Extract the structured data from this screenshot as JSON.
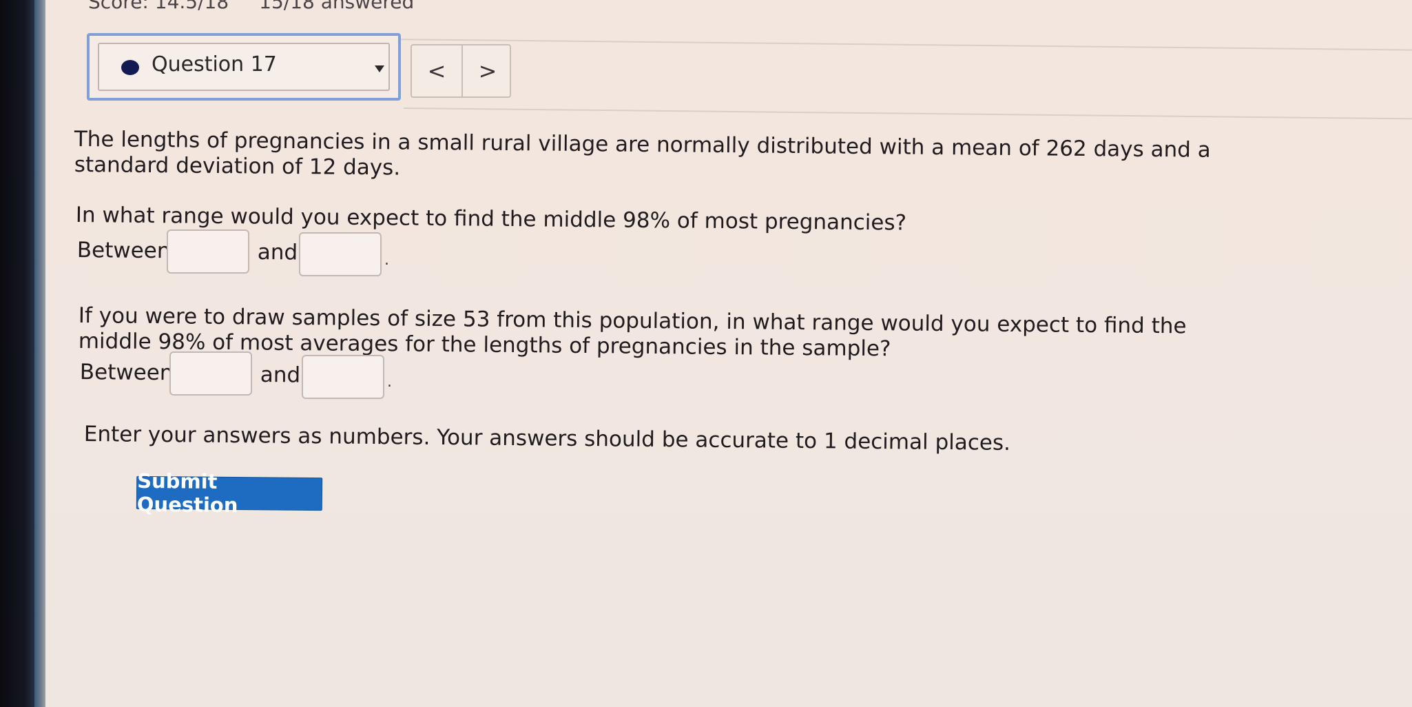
{
  "header": {
    "score_text": "Score: 14.5/18",
    "answered_text": "15/18 answered"
  },
  "question_nav": {
    "selected_question": "Question 17",
    "prev_label": "<",
    "next_label": ">"
  },
  "question": {
    "intro_line1": "The lengths of pregnancies in a small rural village are normally distributed with a mean of 262 days and a",
    "intro_line2": "standard deviation of 12 days.",
    "part1_prompt": "In what range would you expect to find the middle 98% of most pregnancies?",
    "part1_between": "Between",
    "part1_and": "and",
    "part1_period": ".",
    "part2_prompt_line1": "If you were to draw samples of size 53 from this population, in what range would you expect to find the",
    "part2_prompt_line2": "middle 98% of most averages for the lengths of pregnancies in the sample?",
    "part2_between": "Between",
    "part2_and": "and",
    "part2_period": ".",
    "instructions": "Enter your answers as numbers. Your answers should be accurate to 1 decimal places."
  },
  "inputs": {
    "part1_low_value": "",
    "part1_high_value": "",
    "part2_low_value": "",
    "part2_high_value": ""
  },
  "actions": {
    "submit_label": "Submit Question"
  },
  "colors": {
    "accent_blue": "#1e6cc2",
    "focus_outline": "#7f9fd9",
    "question_dot": "#141b52",
    "page_background": "#f0e6df"
  }
}
